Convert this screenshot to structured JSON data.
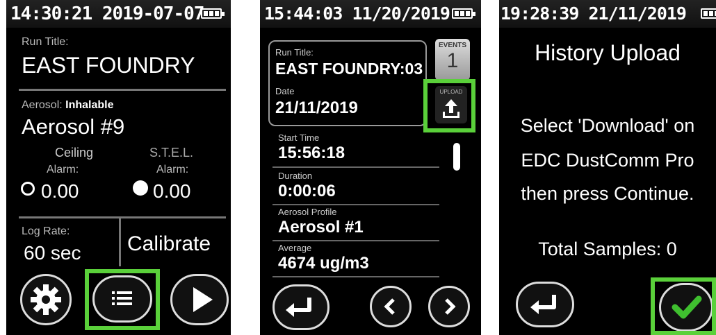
{
  "screen1": {
    "status_time": "14:30:21  2019-07-07",
    "run_title_label": "Run Title:",
    "run_title": "EAST FOUNDRY",
    "aerosol_label": "Aerosol:",
    "aerosol_type": "Inhalable",
    "aerosol_name": "Aerosol #9",
    "ceiling_label": "Ceiling",
    "ceiling_alarm_label": "Alarm:",
    "ceiling_alarm_value": "0.00",
    "stel_label": "S.T.E.L.",
    "stel_alarm_label": "Alarm:",
    "stel_alarm_value": "0.00",
    "log_rate_label": "Log Rate:",
    "log_rate_value": "60 sec",
    "calibrate_label": "Calibrate"
  },
  "screen2": {
    "status_time": "15:44:03  11/20/2019",
    "run_title_label": "Run Title:",
    "run_title": "EAST FOUNDRY:03",
    "date_label": "Date",
    "date_value": "21/11/2019",
    "events_label": "EVENTS",
    "events_count": "1",
    "upload_label": "UPLOAD",
    "start_time_label": "Start Time",
    "start_time_value": "15:56:18",
    "duration_label": "Duration",
    "duration_value": "0:00:06",
    "aerosol_profile_label": "Aerosol Profile",
    "aerosol_profile_value": "Aerosol #1",
    "average_label": "Average",
    "average_value": "4674 ug/m3"
  },
  "screen3": {
    "status_time": "19:28:39  21/11/2019",
    "title": "History Upload",
    "message_line1": "Select 'Download' on",
    "message_line2": "EDC DustComm Pro",
    "message_line3": "then press Continue.",
    "total_samples": "Total Samples: 0"
  },
  "colors": {
    "highlight": "#5ad03a",
    "checkmark": "#3fbf2f"
  }
}
